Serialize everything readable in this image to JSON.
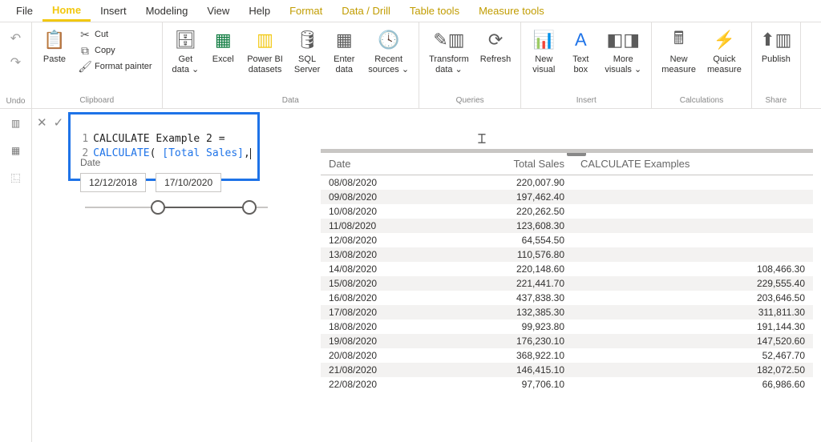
{
  "menubar": {
    "file": "File",
    "tabs": [
      "Home",
      "Insert",
      "Modeling",
      "View",
      "Help"
    ],
    "contextual": [
      "Format",
      "Data / Drill",
      "Table tools",
      "Measure tools"
    ],
    "active": "Home"
  },
  "ribbon": {
    "undo": {
      "label": "Undo"
    },
    "clipboard": {
      "label": "Clipboard",
      "paste": "Paste",
      "cut": "Cut",
      "copy": "Copy",
      "format_painter": "Format painter"
    },
    "data": {
      "label": "Data",
      "get_data": "Get\ndata ⌄",
      "excel": "Excel",
      "pbi_ds": "Power BI\ndatasets",
      "sql": "SQL\nServer",
      "enter": "Enter\ndata",
      "recent": "Recent\nsources ⌄"
    },
    "queries": {
      "label": "Queries",
      "transform": "Transform\ndata ⌄",
      "refresh": "Refresh"
    },
    "insert": {
      "label": "Insert",
      "new_visual": "New\nvisual",
      "text_box": "Text\nbox",
      "more_visuals": "More\nvisuals ⌄"
    },
    "calc": {
      "label": "Calculations",
      "new_measure": "New\nmeasure",
      "quick_measure": "Quick\nmeasure"
    },
    "share": {
      "label": "Share",
      "publish": "Publish"
    }
  },
  "formula": {
    "ln1": "1",
    "txt1": "CALCULATE Example 2 =",
    "ln2": "2",
    "kw2": "CALCULATE",
    "paren": "( ",
    "fld2": "[Total Sales]",
    "tail": ","
  },
  "slicer": {
    "title": "Date",
    "start": "12/12/2018",
    "end": "17/10/2020"
  },
  "table": {
    "headers": [
      "Date",
      "Total Sales",
      "CALCULATE Examples"
    ],
    "rows": [
      {
        "date": "08/08/2020",
        "total": "220,007.90",
        "calc": ""
      },
      {
        "date": "09/08/2020",
        "total": "197,462.40",
        "calc": ""
      },
      {
        "date": "10/08/2020",
        "total": "220,262.50",
        "calc": ""
      },
      {
        "date": "11/08/2020",
        "total": "123,608.30",
        "calc": ""
      },
      {
        "date": "12/08/2020",
        "total": "64,554.50",
        "calc": ""
      },
      {
        "date": "13/08/2020",
        "total": "110,576.80",
        "calc": ""
      },
      {
        "date": "14/08/2020",
        "total": "220,148.60",
        "calc": "108,466.30"
      },
      {
        "date": "15/08/2020",
        "total": "221,441.70",
        "calc": "229,555.40"
      },
      {
        "date": "16/08/2020",
        "total": "437,838.30",
        "calc": "203,646.50"
      },
      {
        "date": "17/08/2020",
        "total": "132,385.30",
        "calc": "311,811.30"
      },
      {
        "date": "18/08/2020",
        "total": "99,923.80",
        "calc": "191,144.30"
      },
      {
        "date": "19/08/2020",
        "total": "176,230.10",
        "calc": "147,520.60"
      },
      {
        "date": "20/08/2020",
        "total": "368,922.10",
        "calc": "52,467.70"
      },
      {
        "date": "21/08/2020",
        "total": "146,415.10",
        "calc": "182,072.50"
      },
      {
        "date": "22/08/2020",
        "total": "97,706.10",
        "calc": "66,986.60"
      }
    ]
  }
}
